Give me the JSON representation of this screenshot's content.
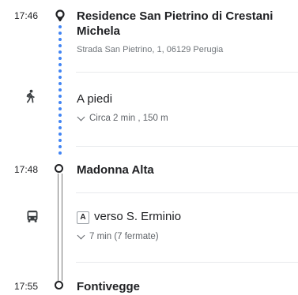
{
  "start": {
    "time": "17:46",
    "name_line1": "Residence San Pietrino di Crestani",
    "name_line2": "Michela",
    "address": "Strada San Pietrino, 1, 06129 Perugia"
  },
  "walk": {
    "mode_icon": "walking-person-icon",
    "label": "A piedi",
    "detail": "Circa 2 min , 150 m"
  },
  "transfer": {
    "time": "17:48",
    "name": "Madonna Alta"
  },
  "bus": {
    "mode_icon": "bus-icon",
    "line": "A",
    "direction": "verso S. Erminio",
    "detail": "7 min (7 fermate)"
  },
  "end": {
    "time": "17:55",
    "name": "Fontivegge"
  },
  "colors": {
    "walk_dots": "#4285f4",
    "text": "#202124",
    "secondary_text": "#70757a",
    "divider": "#e8eaed"
  }
}
